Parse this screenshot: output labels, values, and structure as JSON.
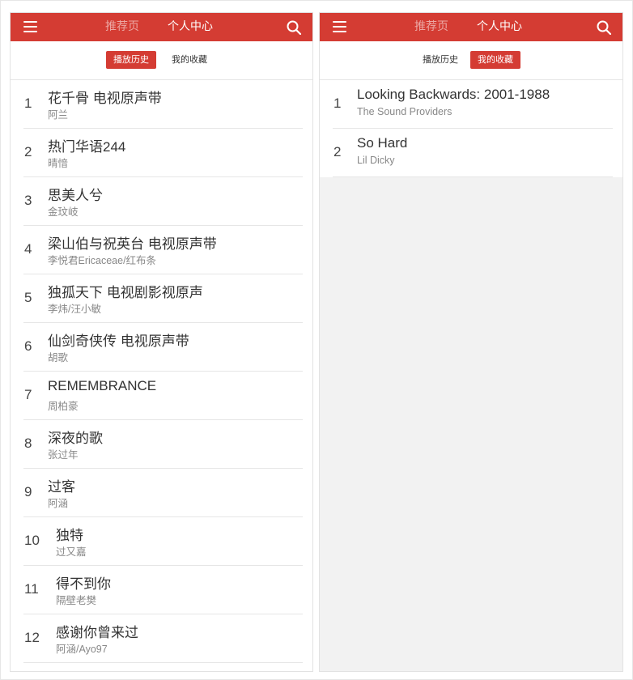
{
  "colors": {
    "accent": "#d43c33",
    "background": "#f2f2f2"
  },
  "icons": {
    "menu": "hamburger-menu-icon",
    "search": "search-icon"
  },
  "left_panel": {
    "nav": {
      "recommend": "推荐页",
      "profile": "个人中心"
    },
    "subtabs": {
      "history": "播放历史",
      "favorites": "我的收藏",
      "active": "history"
    },
    "songs": [
      {
        "rank": "1",
        "title": "花千骨 电视原声带",
        "artist": "阿兰"
      },
      {
        "rank": "2",
        "title": "热门华语244",
        "artist": "晴愔"
      },
      {
        "rank": "3",
        "title": "思美人兮",
        "artist": "金玟岐"
      },
      {
        "rank": "4",
        "title": "梁山伯与祝英台 电视原声带",
        "artist": "李悦君Ericaceae/红布条"
      },
      {
        "rank": "5",
        "title": "独孤天下 电视剧影视原声",
        "artist": "李炜/汪小敏"
      },
      {
        "rank": "6",
        "title": "仙剑奇侠传 电视原声带",
        "artist": "胡歌"
      },
      {
        "rank": "7",
        "title": "REMEMBRANCE",
        "artist": "周柏豪"
      },
      {
        "rank": "8",
        "title": "深夜的歌",
        "artist": "张过年"
      },
      {
        "rank": "9",
        "title": "过客",
        "artist": "阿涵"
      },
      {
        "rank": "10",
        "title": "独特",
        "artist": "过又嘉"
      },
      {
        "rank": "11",
        "title": "得不到你",
        "artist": "隔壁老樊"
      },
      {
        "rank": "12",
        "title": "感谢你曾来过",
        "artist": "阿涵/Ayo97"
      }
    ]
  },
  "right_panel": {
    "nav": {
      "recommend": "推荐页",
      "profile": "个人中心"
    },
    "subtabs": {
      "history": "播放历史",
      "favorites": "我的收藏",
      "active": "favorites"
    },
    "songs": [
      {
        "rank": "1",
        "title": "Looking Backwards: 2001-1988",
        "artist": "The Sound Providers"
      },
      {
        "rank": "2",
        "title": "So Hard",
        "artist": "Lil Dicky"
      }
    ]
  }
}
